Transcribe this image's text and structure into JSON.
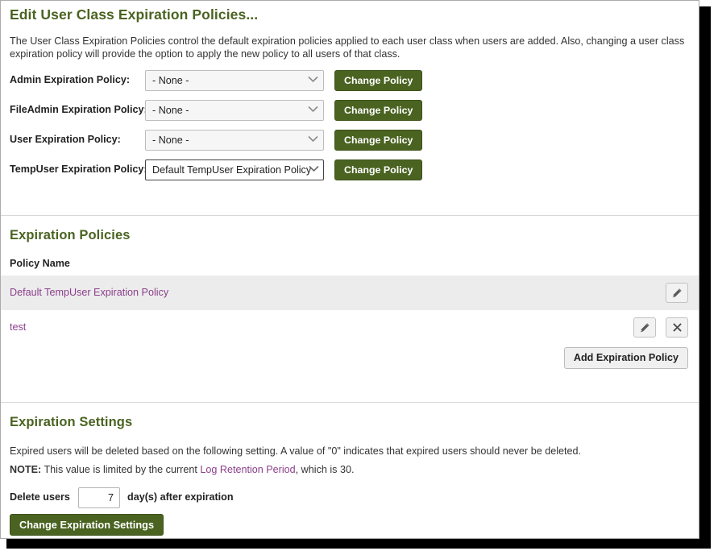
{
  "page": {
    "title": "Edit User Class Expiration Policies...",
    "intro": "The User Class Expiration Policies control the default expiration policies applied to each user class when users are added. Also, changing a user class expiration policy will provide the option to apply the new policy to all users of that class."
  },
  "colors": {
    "heading_green": "#4a6321",
    "button_green": "#4a6321",
    "link_purple": "#8c3f8c",
    "row_shade": "#ececec"
  },
  "user_class_form": {
    "rows": [
      {
        "label": "Admin Expiration Policy:",
        "value": "- None -",
        "button_label": "Change Policy",
        "chevron_icon": "chevron-down-icon"
      },
      {
        "label": "FileAdmin Expiration Policy:",
        "value": "- None -",
        "button_label": "Change Policy",
        "chevron_icon": "chevron-down-icon"
      },
      {
        "label": "User Expiration Policy:",
        "value": "- None -",
        "button_label": "Change Policy",
        "chevron_icon": "chevron-down-icon"
      },
      {
        "label": "TempUser Expiration Policy:",
        "value": "Default TempUser Expiration Policy",
        "button_label": "Change Policy",
        "chevron_icon": "chevron-down-icon"
      }
    ]
  },
  "policies_section": {
    "heading": "Expiration Policies",
    "column_header": "Policy Name",
    "rows": [
      {
        "name": "Default TempUser Expiration Policy",
        "edit_icon": "pencil-icon",
        "has_delete": false
      },
      {
        "name": "test",
        "edit_icon": "pencil-icon",
        "delete_icon": "close-x-icon",
        "has_delete": true
      }
    ],
    "add_button_label": "Add Expiration Policy"
  },
  "settings_section": {
    "heading": "Expiration Settings",
    "description": "Expired users will be deleted based on the following setting. A value of \"0\" indicates that expired users should never be deleted.",
    "note_label": "NOTE:",
    "note_text_before": " This value is limited by the current ",
    "note_link": "Log Retention Period",
    "note_text_after": ", which is 30.",
    "delete_prefix": "Delete users",
    "days_value": "7",
    "delete_suffix": "day(s) after expiration",
    "submit_label": "Change Expiration Settings"
  }
}
